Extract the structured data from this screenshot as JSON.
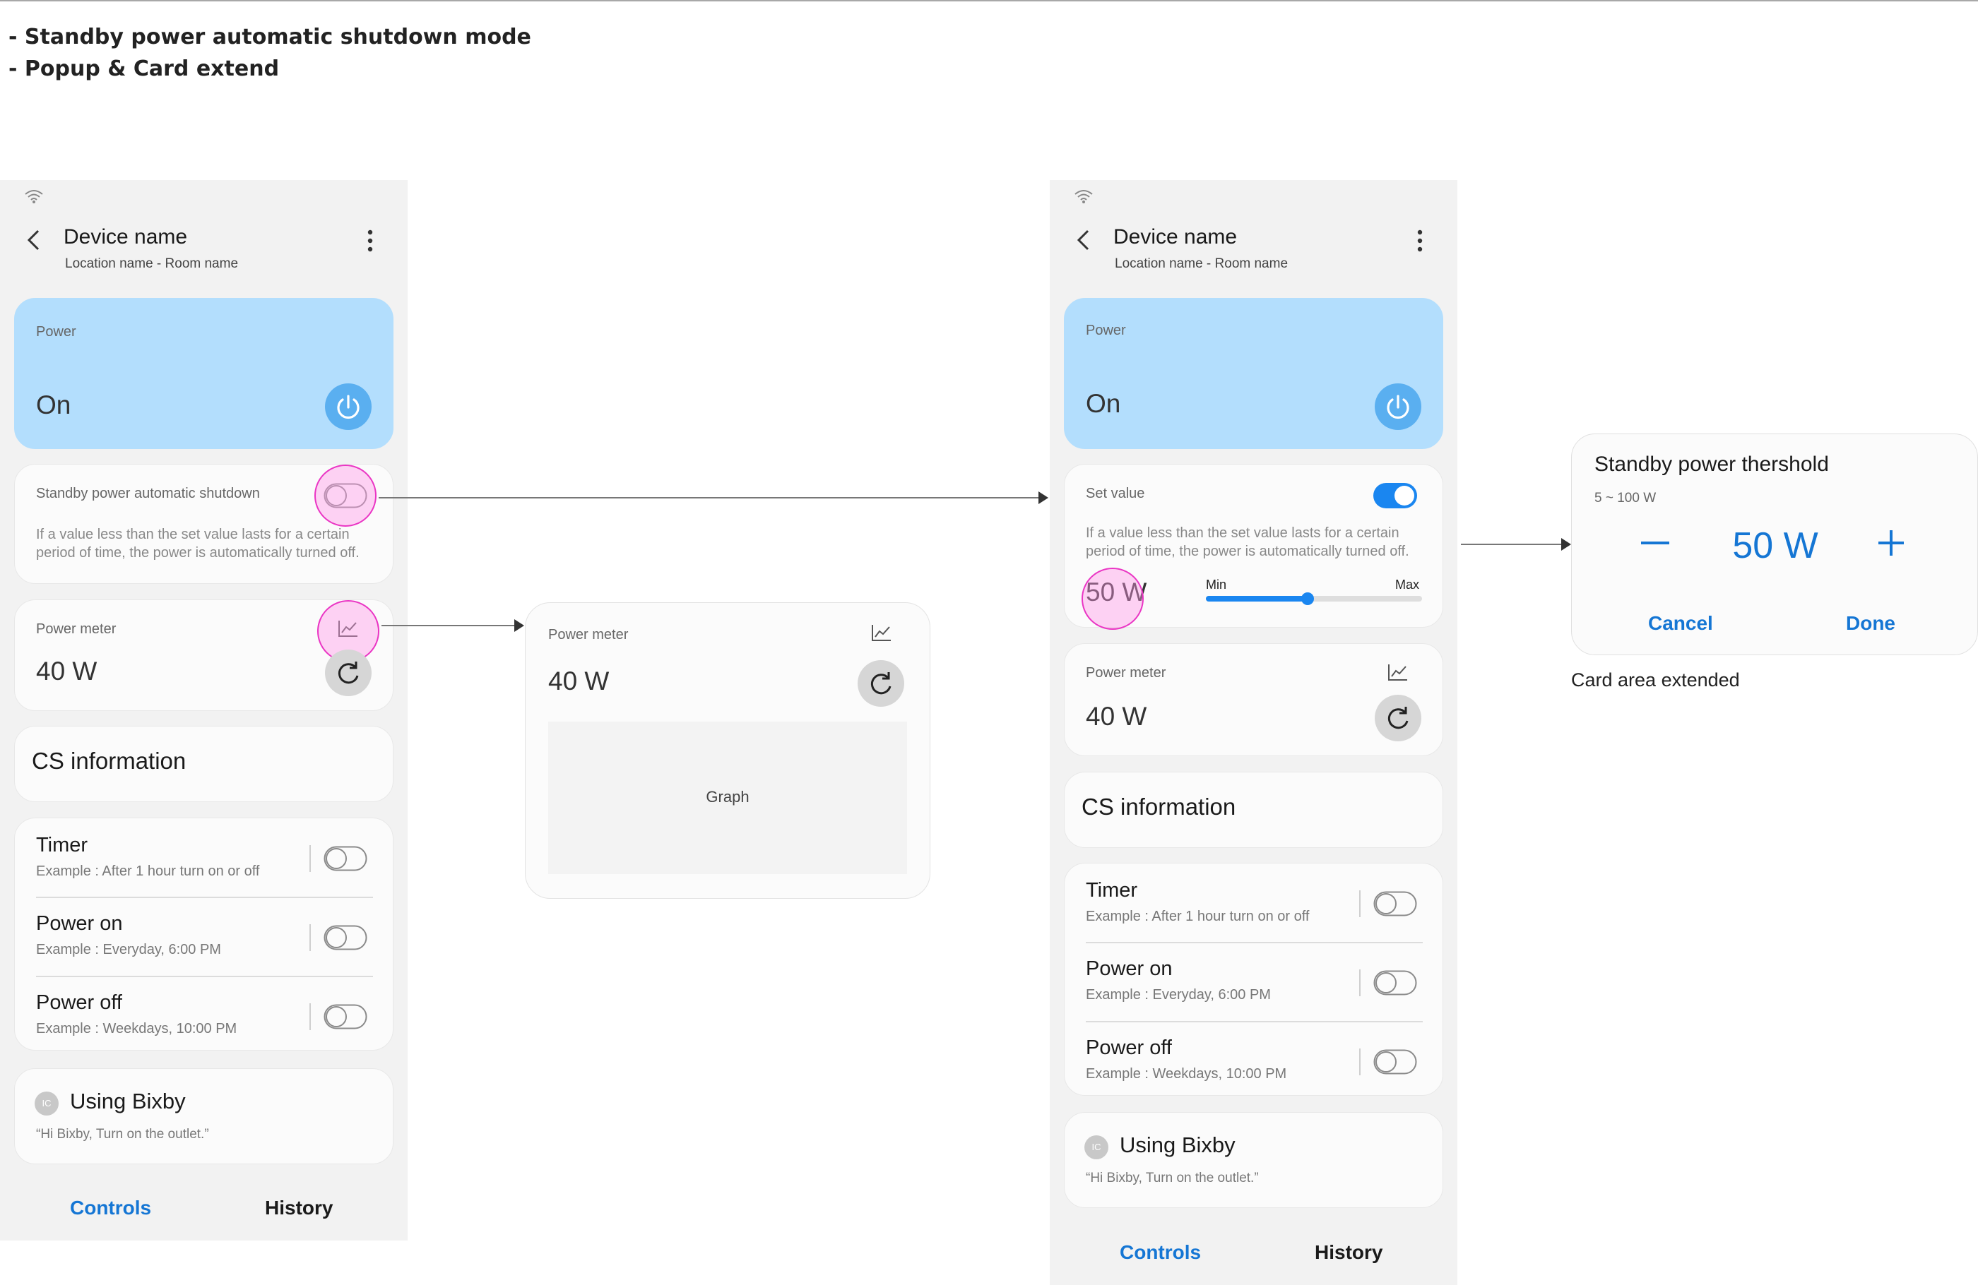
{
  "notes": [
    "- Standby power automatic shutdown mode",
    "- Popup & Card extend"
  ],
  "colors": {
    "accent": "#1576d4",
    "power_card": "#b3defd",
    "power_button": "#5aaff0",
    "highlight": "#ea35c4",
    "toggle_on": "#1a86f0"
  },
  "screen_a": {
    "device_title": "Device name",
    "location": "Location name - Room name",
    "power": {
      "label": "Power",
      "state": "On"
    },
    "standby": {
      "label": "Standby power automatic shutdown",
      "description": "If a value less than the set value lasts for a certain period of time, the power is automatically turned off.",
      "toggle_on": false
    },
    "meter": {
      "label": "Power meter",
      "value": "40 W"
    },
    "cs_info": "CS information",
    "schedules": [
      {
        "title": "Timer",
        "subtitle": "Example : After 1 hour turn on or off",
        "toggle_on": false
      },
      {
        "title": "Power on",
        "subtitle": "Example : Everyday, 6:00 PM",
        "toggle_on": false
      },
      {
        "title": "Power off",
        "subtitle": "Example : Weekdays, 10:00 PM",
        "toggle_on": false
      }
    ],
    "bixby": {
      "icon_text": "IC",
      "title": "Using Bixby",
      "subtitle": "“Hi Bixby, Turn on the outlet.”"
    },
    "tabs": {
      "controls": "Controls",
      "history": "History"
    }
  },
  "meter_extended": {
    "label": "Power meter",
    "value": "40 W",
    "graph_label": "Graph"
  },
  "screen_b": {
    "device_title": "Device name",
    "location": "Location name - Room name",
    "power": {
      "label": "Power",
      "state": "On"
    },
    "set_value": {
      "label": "Set value",
      "description": "If a value less than the set value lasts for a certain period of time, the power is automatically turned off.",
      "value": "50 W",
      "slider_min": "Min",
      "slider_max": "Max",
      "slider_fraction": 0.47,
      "toggle_on": true
    },
    "meter": {
      "label": "Power meter",
      "value": "40 W"
    },
    "cs_info": "CS information",
    "schedules": [
      {
        "title": "Timer",
        "subtitle": "Example : After 1 hour turn on or off",
        "toggle_on": false
      },
      {
        "title": "Power on",
        "subtitle": "Example : Everyday, 6:00 PM",
        "toggle_on": false
      },
      {
        "title": "Power off",
        "subtitle": "Example : Weekdays, 10:00 PM",
        "toggle_on": false
      }
    ],
    "bixby": {
      "icon_text": "IC",
      "title": "Using Bixby",
      "subtitle": "“Hi Bixby, Turn on the outlet.”"
    },
    "tabs": {
      "controls": "Controls",
      "history": "History"
    }
  },
  "popup": {
    "title": "Standby power thershold",
    "range": "5 ~ 100 W",
    "value": "50 W",
    "cancel": "Cancel",
    "done": "Done",
    "caption": "Card area extended"
  }
}
